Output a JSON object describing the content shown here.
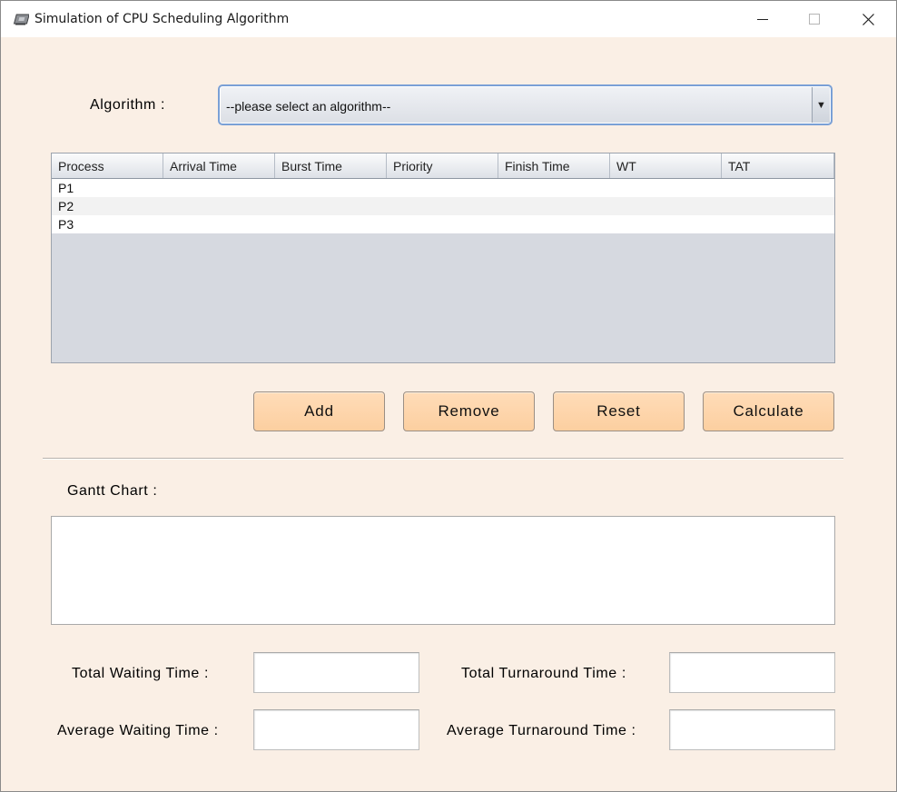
{
  "window": {
    "title": "Simulation of CPU Scheduling Algorithm",
    "app_icon": "cpu-chip-icon",
    "controls": [
      "minimize-icon",
      "maximize-icon",
      "close-icon"
    ]
  },
  "algorithm": {
    "label": "Algorithm :",
    "selected": "--please select an algorithm--"
  },
  "table": {
    "columns": [
      "Process",
      "Arrival Time",
      "Burst Time",
      "Priority",
      "Finish Time",
      "WT",
      "TAT"
    ],
    "rows": [
      [
        "P1",
        "",
        "",
        "",
        "",
        "",
        ""
      ],
      [
        "P2",
        "",
        "",
        "",
        "",
        "",
        ""
      ],
      [
        "P3",
        "",
        "",
        "",
        "",
        "",
        ""
      ]
    ]
  },
  "buttons": {
    "add": "Add",
    "remove": "Remove",
    "reset": "Reset",
    "calculate": "Calculate"
  },
  "gantt": {
    "label": "Gantt Chart :"
  },
  "stats": {
    "total_waiting_label": "Total Waiting Time :",
    "total_waiting_value": "",
    "average_waiting_label": "Average Waiting Time :",
    "average_waiting_value": "",
    "total_turnaround_label": "Total Turnaround Time :",
    "total_turnaround_value": "",
    "average_turnaround_label": "Average Turnaround Time :",
    "average_turnaround_value": ""
  },
  "colors": {
    "window_bg": "#faefe5",
    "button_bg": "#fdd4a8",
    "table_empty_bg": "#d6d9e0",
    "combo_border": "#7aa0d6"
  }
}
